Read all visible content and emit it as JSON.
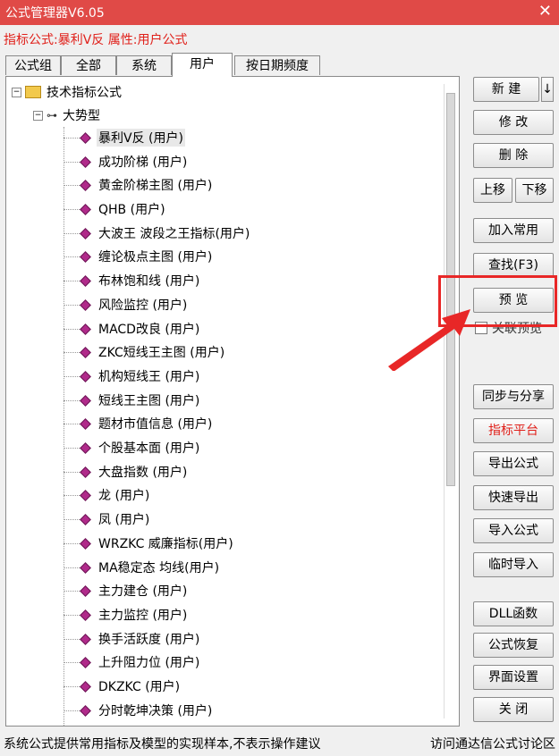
{
  "window": {
    "title": "公式管理器V6.05",
    "close_icon": "✕"
  },
  "infobar": {
    "text": "指标公式:暴利V反  属性:用户公式"
  },
  "tabs": [
    "公式组",
    "全部",
    "系统",
    "用户",
    "按日期频度"
  ],
  "tree": {
    "root_toggle": "−",
    "root_label": "技术指标公式",
    "sub_toggle": "−",
    "sub_label": "大势型",
    "items": [
      "暴利V反 (用户)",
      "成功阶梯 (用户)",
      "黄金阶梯主图 (用户)",
      "QHB (用户)",
      "大波王  波段之王指标(用户)",
      "缠论极点主图 (用户)",
      "布林饱和线 (用户)",
      "风险监控 (用户)",
      "MACD改良 (用户)",
      "ZKC短线王主图 (用户)",
      "机构短线王 (用户)",
      "短线王主图 (用户)",
      "题材市值信息 (用户)",
      "个股基本面 (用户)",
      "大盘指数 (用户)",
      "龙 (用户)",
      "凤 (用户)",
      "WRZKC 威廉指标(用户)",
      "MA稳定态  均线(用户)",
      "主力建仓 (用户)",
      "主力监控 (用户)",
      "换手活跃度 (用户)",
      "上升阻力位 (用户)",
      "DKZKC (用户)",
      "分时乾坤决策 (用户)"
    ]
  },
  "buttons": {
    "new": "新 建",
    "new_arrow": "↓",
    "edit": "修 改",
    "delete": "删 除",
    "move_up": "上移",
    "move_down": "下移",
    "add_common": "加入常用",
    "find": "查找(F3)",
    "preview": "预 览",
    "linked_preview": "关联预览",
    "sync_share": "同步与分享",
    "indicator_platform": "指标平台",
    "export": "导出公式",
    "quick_export": "快速导出",
    "import": "导入公式",
    "temp_import": "临时导入",
    "dll": "DLL函数",
    "restore": "公式恢复",
    "ui_settings": "界面设置",
    "close": "关 闭"
  },
  "status": {
    "left": "系统公式提供常用指标及模型的实现样本,不表示操作建议",
    "right": "访问通达信公式讨论区"
  },
  "colors": {
    "title_bar": "#e04a47",
    "accent_red": "#e0201a",
    "highlight": "#e82727"
  }
}
